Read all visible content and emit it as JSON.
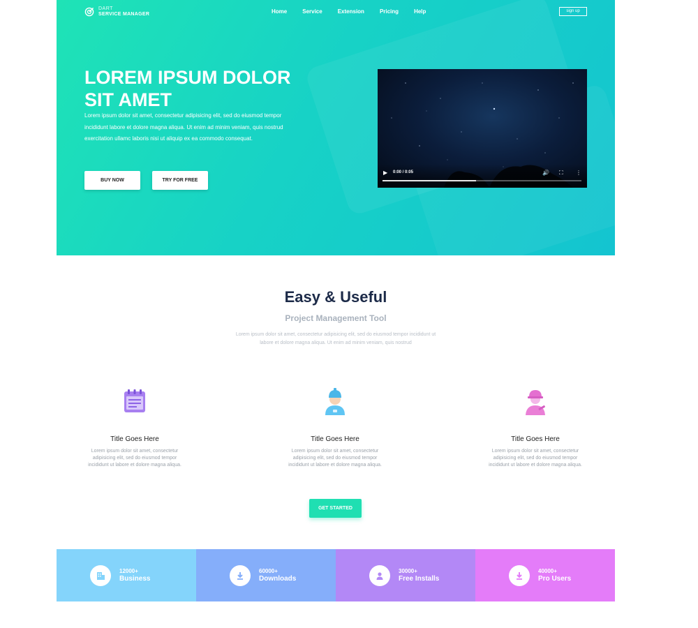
{
  "brand": {
    "line1": "DART",
    "line2": "SERVICE MANAGER"
  },
  "nav": {
    "items": [
      "Home",
      "Service",
      "Extension",
      "Pricing",
      "Help"
    ],
    "signup": "sign up"
  },
  "hero": {
    "title": "LOREM IPSUM DOLOR SIT AMET",
    "paragraph": "Lorem ipsum dolor sit amet, consectetur adipisicing elit, sed do eiusmod tempor incididunt labore et dolore magna aliqua. Ut enim ad minim veniam, quis nostrud exercitation ullamc laboris nisi ut aliquip ex ea commodo consequat.",
    "buy_now": "BUY NOW",
    "try_free": "TRY FOR FREE",
    "video": {
      "time": "0:00 / 0:05",
      "progress": 0.47
    }
  },
  "features": {
    "title": "Easy & Useful",
    "subtitle": "Project Management Tool",
    "paragraph": "Lorem ipsum dolor sit amet, consectetur adipisicing elit, sed do eiusmod tempor incididunt ut labore et dolore magna aliqua. Ut enim ad minim veniam, quis nostrud",
    "items": [
      {
        "icon": "notepad-icon",
        "title": "Title Goes Here",
        "text": "Lorem ipsum dolor sit amet, consectetur adipisicing elit, sed do eiusmod tempor incididunt ut labore et dolore magna aliqua."
      },
      {
        "icon": "worker-icon",
        "title": "Title Goes Here",
        "text": "Lorem ipsum dolor sit amet, consectetur adipisicing elit, sed do eiusmod tempor incididunt ut labore et dolore magna aliqua."
      },
      {
        "icon": "engineer-icon",
        "title": "Title Goes Here",
        "text": "Lorem ipsum dolor sit amet, consectetur adipisicing elit, sed do eiusmod tempor incididunt ut labore et dolore magna aliqua."
      }
    ],
    "cta": "GET STARTED"
  },
  "stats": [
    {
      "number": "12000+",
      "label": "Business",
      "icon": "building-icon",
      "color": "#84d4fb"
    },
    {
      "number": "60000+",
      "label": "Downloads",
      "icon": "download-icon",
      "color": "#85aefa"
    },
    {
      "number": "30000+",
      "label": "Free Installs",
      "icon": "user-icon",
      "color": "#b388f6"
    },
    {
      "number": "40000+",
      "label": "Pro Users",
      "icon": "download-icon",
      "color": "#e47cf9"
    }
  ],
  "colors": {
    "accent": "#1fdfb2",
    "hero_start": "#1fe3b6",
    "hero_end": "#14c4d0",
    "heading": "#1c2a48"
  }
}
